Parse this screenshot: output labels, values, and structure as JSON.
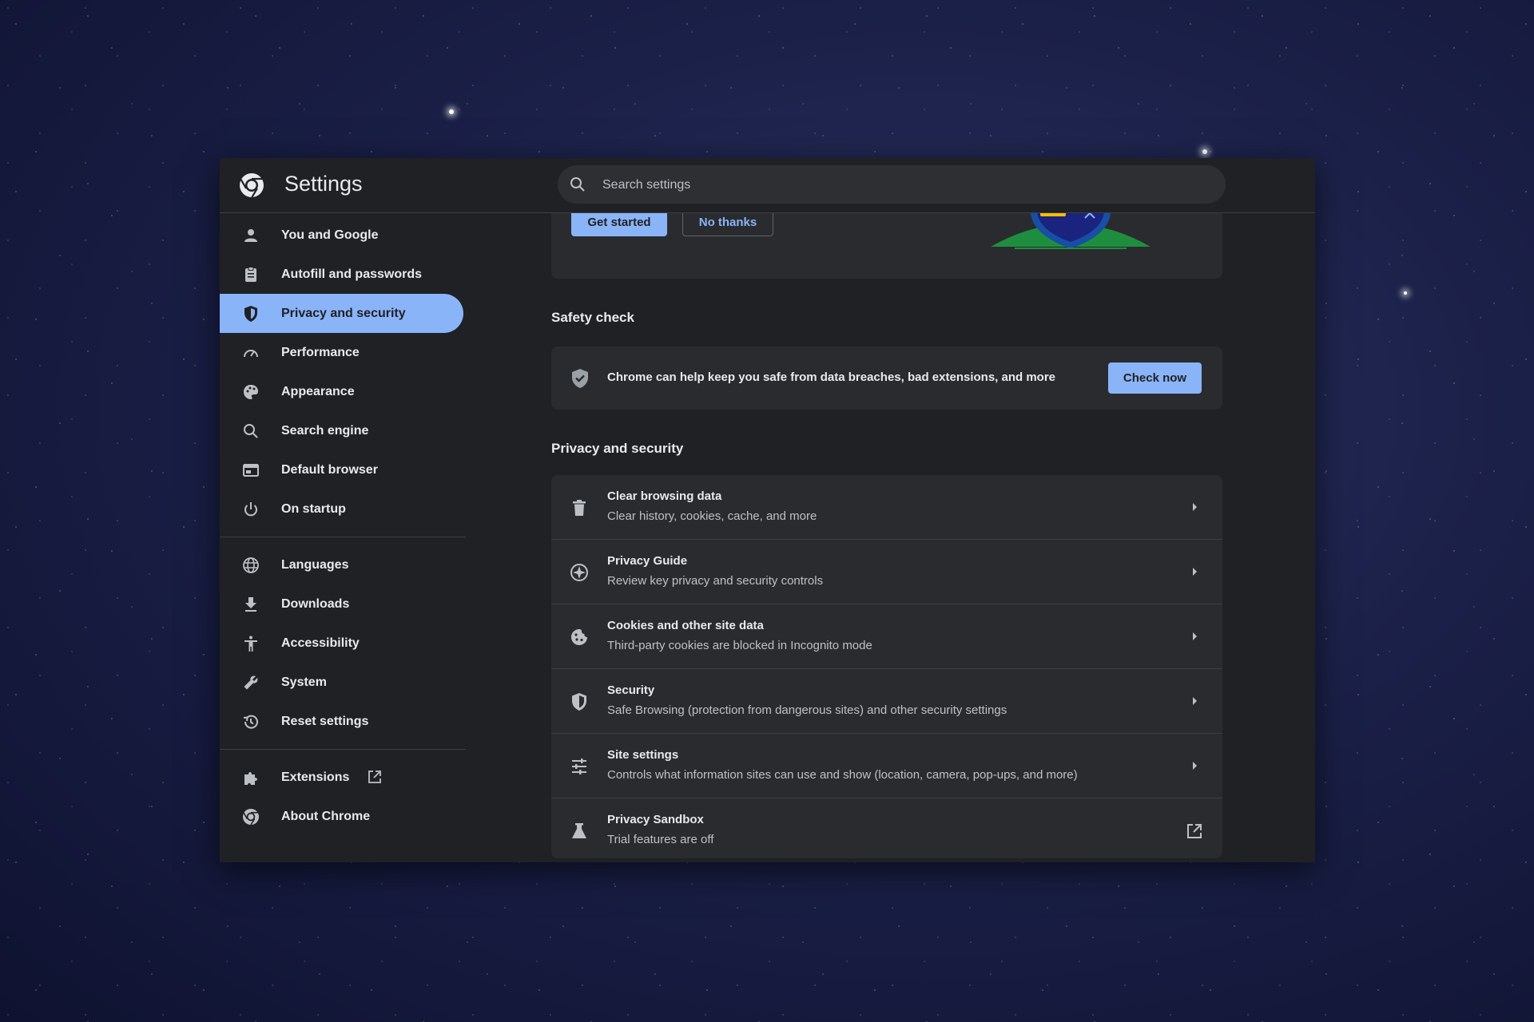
{
  "app": {
    "title": "Settings"
  },
  "search": {
    "placeholder": "Search settings"
  },
  "sidebar": {
    "items": [
      {
        "label": "You and Google",
        "icon": "person-icon"
      },
      {
        "label": "Autofill and passwords",
        "icon": "clipboard-icon"
      },
      {
        "label": "Privacy and security",
        "icon": "shield-icon",
        "active": true
      },
      {
        "label": "Performance",
        "icon": "speedometer-icon"
      },
      {
        "label": "Appearance",
        "icon": "palette-icon"
      },
      {
        "label": "Search engine",
        "icon": "search-icon"
      },
      {
        "label": "Default browser",
        "icon": "browser-icon"
      },
      {
        "label": "On startup",
        "icon": "power-icon"
      }
    ],
    "items2": [
      {
        "label": "Languages",
        "icon": "globe-icon"
      },
      {
        "label": "Downloads",
        "icon": "download-icon"
      },
      {
        "label": "Accessibility",
        "icon": "accessibility-icon"
      },
      {
        "label": "System",
        "icon": "wrench-icon"
      },
      {
        "label": "Reset settings",
        "icon": "history-icon"
      }
    ],
    "items3": [
      {
        "label": "Extensions",
        "icon": "puzzle-icon",
        "external": true
      },
      {
        "label": "About Chrome",
        "icon": "chrome-icon"
      }
    ]
  },
  "promo": {
    "get_started": "Get started",
    "no_thanks": "No thanks"
  },
  "safety_check": {
    "heading": "Safety check",
    "text": "Chrome can help keep you safe from data breaches, bad extensions, and more",
    "button": "Check now"
  },
  "privacy": {
    "heading": "Privacy and security",
    "rows": [
      {
        "title": "Clear browsing data",
        "subtitle": "Clear history, cookies, cache, and more",
        "icon": "trash-icon"
      },
      {
        "title": "Privacy Guide",
        "subtitle": "Review key privacy and security controls",
        "icon": "compass-icon"
      },
      {
        "title": "Cookies and other site data",
        "subtitle": "Third-party cookies are blocked in Incognito mode",
        "icon": "cookie-icon"
      },
      {
        "title": "Security",
        "subtitle": "Safe Browsing (protection from dangerous sites) and other security settings",
        "icon": "shield-icon"
      },
      {
        "title": "Site settings",
        "subtitle": "Controls what information sites can use and show (location, camera, pop-ups, and more)",
        "icon": "sliders-icon"
      },
      {
        "title": "Privacy Sandbox",
        "subtitle": "Trial features are off",
        "icon": "flask-icon",
        "external": true
      }
    ]
  },
  "colors": {
    "accent": "#8ab4f8",
    "surface": "#202124",
    "card": "#2a2b2e"
  }
}
